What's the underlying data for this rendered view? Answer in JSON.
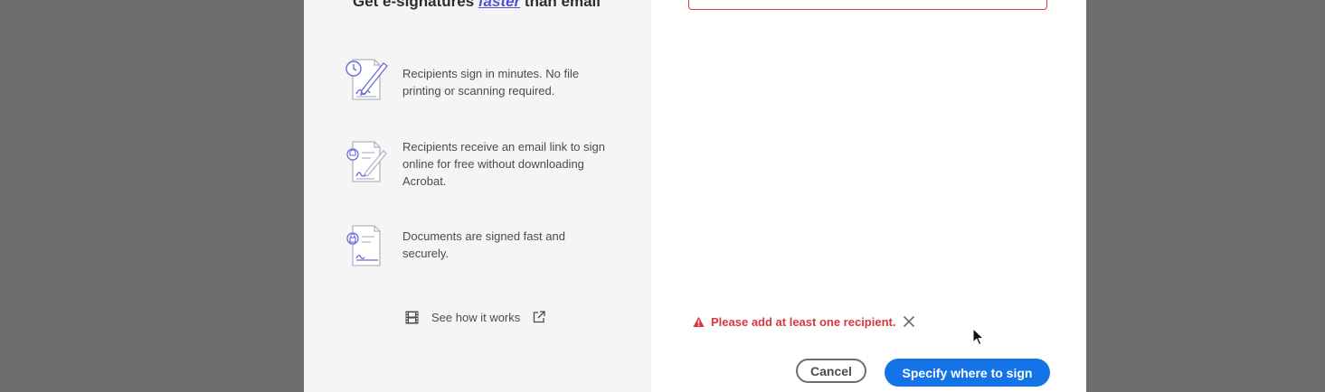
{
  "left_panel": {
    "headline_pre": "Get e-signatures ",
    "headline_emph": "faster",
    "headline_post": " than email",
    "features": [
      {
        "icon": "sign-document-clock-icon",
        "text": "Recipients sign in minutes. No file printing or scanning required."
      },
      {
        "icon": "email-document-pen-icon",
        "text": "Recipients receive an email link to sign online for free without downloading Acrobat."
      },
      {
        "icon": "secure-document-lock-icon",
        "text": "Documents are signed fast and securely."
      }
    ],
    "see_how_label": "See how it works",
    "see_how_icon": "film-icon",
    "external_icon": "external-link-icon"
  },
  "right_panel": {
    "error_message": "Please add at least one recipient.",
    "error_icon": "warning-icon",
    "dismiss_icon": "close-icon"
  },
  "footer": {
    "cancel_label": "Cancel",
    "primary_label": "Specify where to sign"
  },
  "colors": {
    "overlay": "#6e6e6e",
    "panel_bg": "#f5f5f5",
    "accent_blue": "#1473e6",
    "error_red": "#d7373f",
    "link_purple": "#5151d3"
  }
}
